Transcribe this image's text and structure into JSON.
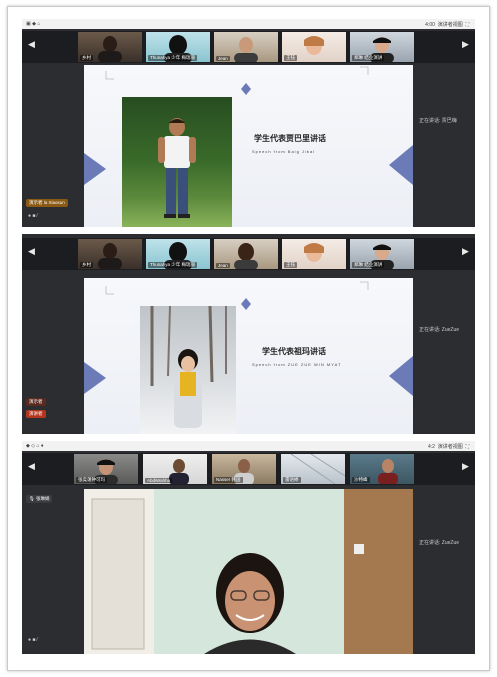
{
  "panel1": {
    "status_time": "4:00",
    "status_mode": "演讲者视图",
    "participants": [
      "乡村",
      "Thunahya 少年 梅瑞丽",
      "Jean",
      "王钰",
      "郑琳 结业演讲"
    ],
    "slide_title": "学生代表贾巴里讲话",
    "slide_subtitle": "Speech from Baig Jibal",
    "side_label": "正在讲话: 贾巴嗨",
    "chip_label": "演示者 la Xiaosun"
  },
  "panel2": {
    "participants": [
      "乡村",
      "Thunahya 少年 梅瑞丽",
      "Jean",
      "王钰",
      "郑琳 结业演讲"
    ],
    "slide_title": "学生代表祖玛讲话",
    "slide_subtitle": "Speech from ZUE ZUE WIN MYAT",
    "side_label": "正在讲话: ZueZue",
    "chip1_label": "演示者",
    "chip2_label": "演讲者"
  },
  "panel3": {
    "status_time": "4:2",
    "status_mode": "演讲者视图",
    "participants": [
      "张奕蔼钟可玛",
      "AbdiWahha",
      "Nasser 韩国",
      "雷语婷",
      "沙特峰"
    ],
    "top_left_label": "张琳娟",
    "side_label": "正在讲话: ZueZue"
  }
}
